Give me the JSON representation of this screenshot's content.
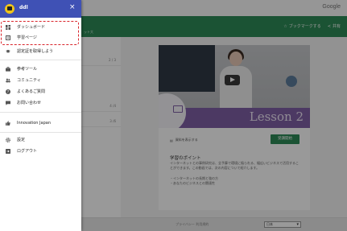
{
  "background": {
    "brand": "Google",
    "appbar_subtitle": "ット大",
    "bookmark_label": "ブックマークする",
    "share_label": "共有",
    "lesson_rows": [
      "2 / 3",
      "4 /4",
      "3 /6"
    ],
    "lesson_title": "Lesson 2",
    "download_label": "資料を表示する",
    "enroll_label": "受講開始",
    "point_title": "学習のポイント",
    "point_desc": "インターネットとの事例研究は、全予算で環境に陥られる、幅広いビジネスで活用することができます。この動画では、次の内容について紹介します。",
    "bullets": [
      "・インターネットの長期と強の方",
      "・あなたのビジネスとの関連性"
    ],
    "footer_links": "プライバシー   利用規約",
    "language": "日本"
  },
  "drawer": {
    "username": "ddl",
    "close_glyph": "×",
    "items": [
      {
        "label": "ダッシュボード"
      },
      {
        "label": "学習ページ"
      },
      {
        "label": "認定証を取得しよう"
      },
      {
        "label": "参考ツール"
      },
      {
        "label": "コミュニティ"
      },
      {
        "label": "よくあるご質問"
      },
      {
        "label": "お問い合わせ"
      },
      {
        "label": "Innovation Japan"
      },
      {
        "label": "設定"
      },
      {
        "label": "ログアウト"
      }
    ]
  },
  "colors": {
    "drawer_header": "#3f51b5",
    "app_green": "#2e8b57",
    "lesson_purple": "#7f5fa6",
    "highlight_red": "#d9252b"
  },
  "icons": {
    "dashboard": "dashboard-grid-icon",
    "learning": "book-icon",
    "certificate": "graduation-cap-icon",
    "tools": "briefcase-icon",
    "community": "people-icon",
    "faq": "help-circle-icon",
    "contact": "chat-icon",
    "innovation": "thumbs-up-icon",
    "settings": "gear-icon",
    "logout": "logout-icon"
  }
}
